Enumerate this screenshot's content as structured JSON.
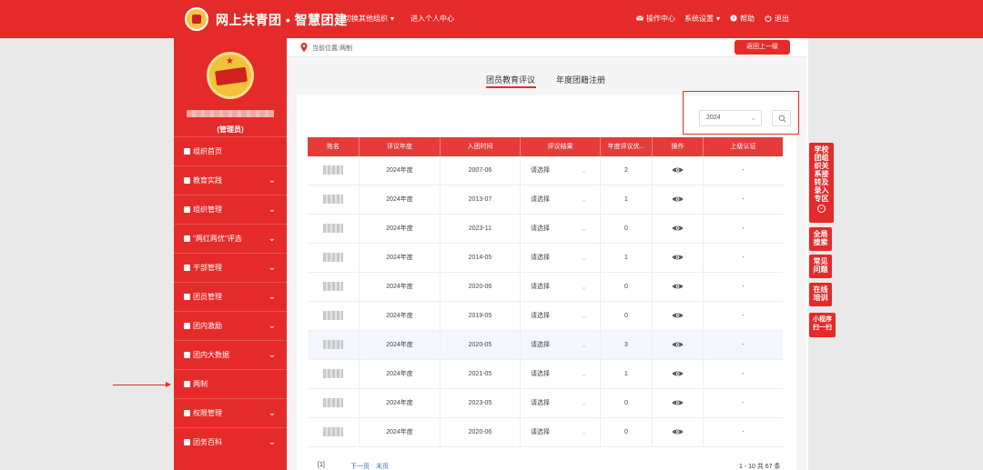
{
  "header": {
    "title": "网上共青团 • 智慧团建",
    "switch_org": "切换其他组织",
    "personal_center": "进入个人中心",
    "ops_center": "操作中心",
    "settings": "系统设置",
    "help": "帮助",
    "logout": "退出"
  },
  "sidebar": {
    "role": "(管理员)",
    "items": [
      {
        "label": "组织首页"
      },
      {
        "label": "教育实践"
      },
      {
        "label": "组织管理"
      },
      {
        "label": "\"两红两优\"评选"
      },
      {
        "label": "干部管理"
      },
      {
        "label": "团员管理"
      },
      {
        "label": "团内激励"
      },
      {
        "label": "团内大数据"
      },
      {
        "label": "两制"
      },
      {
        "label": "权限管理"
      },
      {
        "label": "团务百科"
      }
    ]
  },
  "breadcrumb": "当前位置:两制",
  "back_button": "返回上一级",
  "tabs": [
    {
      "label": "团员教育评议"
    },
    {
      "label": "年度团籍注册"
    }
  ],
  "filter": {
    "year": "2024"
  },
  "table": {
    "headers": [
      "姓名",
      "评议年度",
      "入团时间",
      "评议结果",
      "年度评议优...",
      "操作",
      "上级认证"
    ],
    "select_placeholder": "请选择",
    "rows": [
      {
        "year": "2024年度",
        "join": "2007-06",
        "count": "2",
        "cert": "-"
      },
      {
        "year": "2024年度",
        "join": "2013-07",
        "count": "1",
        "cert": "-"
      },
      {
        "year": "2024年度",
        "join": "2023-11",
        "count": "0",
        "cert": "-"
      },
      {
        "year": "2024年度",
        "join": "2014-05",
        "count": "1",
        "cert": "-"
      },
      {
        "year": "2024年度",
        "join": "2020-06",
        "count": "0",
        "cert": "-"
      },
      {
        "year": "2024年度",
        "join": "2019-05",
        "count": "0",
        "cert": "-"
      },
      {
        "year": "2024年度",
        "join": "2020-05",
        "count": "3",
        "cert": "-"
      },
      {
        "year": "2024年度",
        "join": "2021-05",
        "count": "1",
        "cert": "-"
      },
      {
        "year": "2024年度",
        "join": "2023-05",
        "count": "0",
        "cert": "-"
      },
      {
        "year": "2024年度",
        "join": "2020-06",
        "count": "0",
        "cert": "-"
      }
    ]
  },
  "pagination": {
    "current": "[1]",
    "next": "下一页",
    "last": "末页",
    "summary": "1 - 10 共 67 条"
  },
  "float_links": [
    {
      "label": "学校团组织关系接转及录入专区"
    },
    {
      "label": "全局搜索"
    },
    {
      "label": "常见问题"
    },
    {
      "label": "在线培训"
    },
    {
      "label": "小程序扫一扫"
    }
  ],
  "colors": {
    "brand_red": "#e52a2a",
    "table_header": "#e53b3b"
  }
}
